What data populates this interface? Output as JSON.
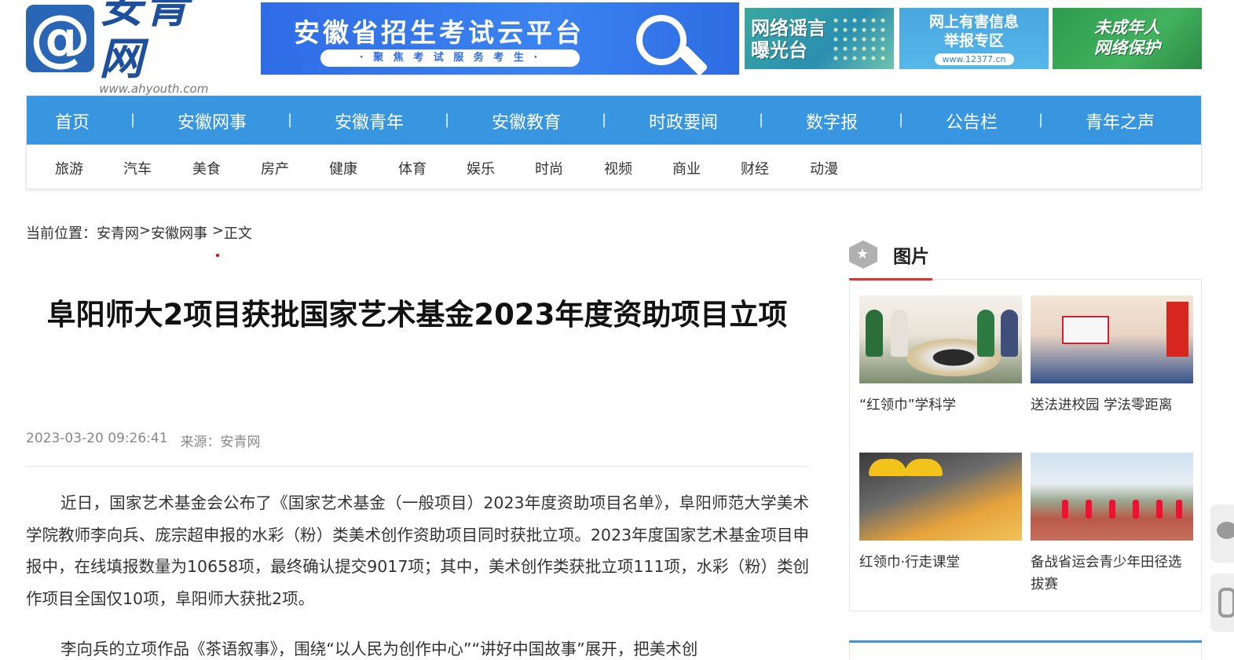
{
  "header": {
    "logo_symbol": "@",
    "logo_cn": "安青网",
    "logo_url": "www.ahyouth.com",
    "banner_main_title": "安徽省招生考试云平台",
    "banner_main_sub": "· 聚 焦 考 试   服 务 考 生 ·",
    "banner_rumor": "网络谣言\n曝光台",
    "banner_report_title": "网上有害信息\n举报专区",
    "banner_report_url": "www.12377.cn",
    "banner_minor": "未成年人\n网络保护"
  },
  "nav": {
    "main": [
      "首页",
      "安徽网事",
      "安徽青年",
      "安徽教育",
      "时政要闻",
      "数字报",
      "公告栏",
      "青年之声"
    ],
    "separator": "|",
    "sub": [
      "旅游",
      "汽车",
      "美食",
      "房产",
      "健康",
      "体育",
      "娱乐",
      "时尚",
      "视频",
      "商业",
      "财经",
      "动漫"
    ]
  },
  "breadcrumb": {
    "prefix": "当前位置：",
    "home": "安青网",
    "gt1": ">",
    "section": "安徽网事",
    "gt2": " >",
    "current": "正文"
  },
  "article": {
    "title": "阜阳师大2项目获批国家艺术基金2023年度资助项目立项",
    "date": "2023-03-20 09:26:41",
    "source": "来源：安青网",
    "p1": "近日，国家艺术基金会公布了《国家艺术基金（一般项目）2023年度资助项目名单》，阜阳师范大学美术学院教师李向兵、庞宗超申报的水彩（粉）类美术创作资助项目同时获批立项。2023年度国家艺术基金项目申报中，在线填报数量为10658项，最终确认提交9017项；其中，美术创作类获批立项111项，水彩（粉）类创作项目全国仅10项，阜阳师大获批2项。",
    "p2": "李向兵的立项作品《茶语叙事》，围绕“以人民为创作中心”“讲好中国故事”展开，把美术创"
  },
  "sidebar": {
    "title": "图片",
    "cards": [
      {
        "caption": "“红领巾”学科学"
      },
      {
        "caption": "送法进校园 学法零距离"
      },
      {
        "caption": "红领巾·行走课堂"
      },
      {
        "caption": "备战省运会青少年田径选拔赛"
      }
    ]
  },
  "colors": {
    "nav_blue": "#3895e0",
    "accent_red": "#d33333",
    "logo_blue": "#2a66b6"
  }
}
